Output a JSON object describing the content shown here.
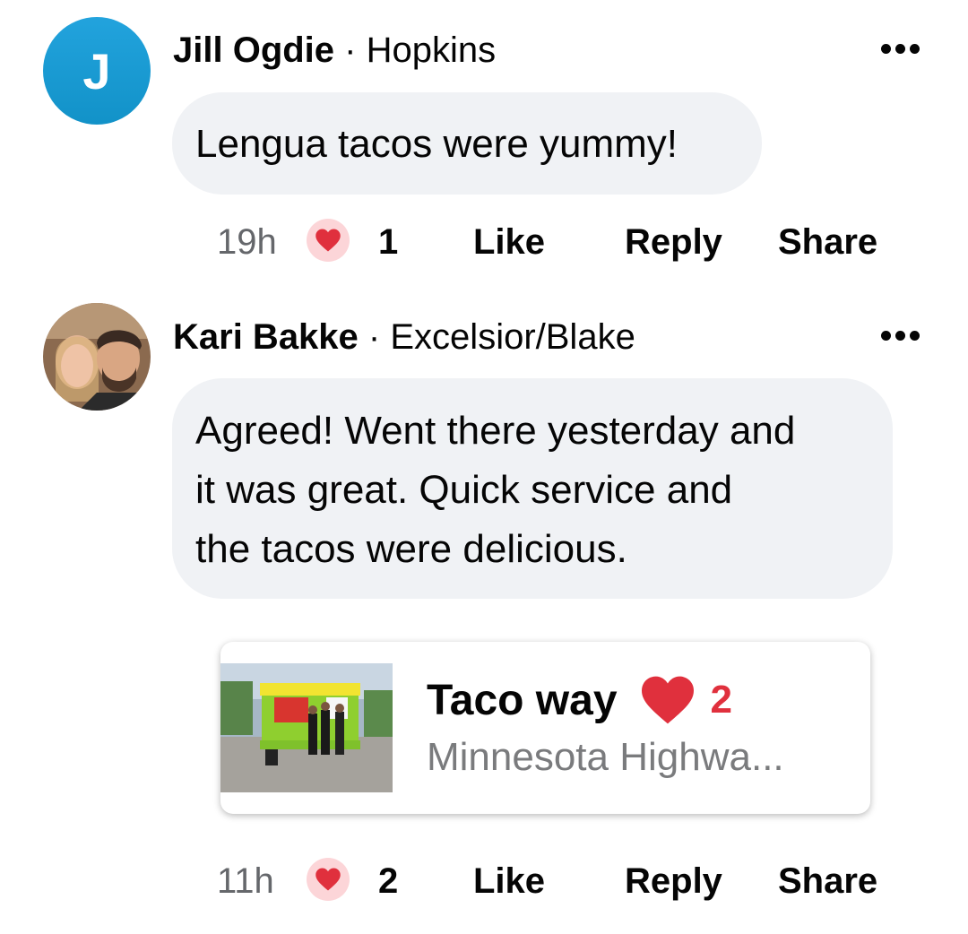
{
  "comments": [
    {
      "avatar_letter": "J",
      "name": "Jill Ogdie",
      "separator": "·",
      "location": "Hopkins",
      "text": "Lengua tacos were yummy!",
      "time": "19h",
      "reaction_icon": "heart-icon",
      "reaction_count": "1",
      "like_label": "Like",
      "reply_label": "Reply",
      "share_label": "Share"
    },
    {
      "name": "Kari Bakke",
      "separator": "·",
      "location": "Excelsior/Blake",
      "text": "Agreed! Went there yesterday and\nit was great. Quick service and\nthe tacos were delicious.",
      "time": "11h",
      "reaction_icon": "heart-icon",
      "reaction_count": "2",
      "like_label": "Like",
      "reply_label": "Reply",
      "share_label": "Share",
      "attachment": {
        "title": "Taco way",
        "heart_count": "2",
        "subtitle": "Minnesota Highwa..."
      }
    }
  ],
  "colors": {
    "bubble_bg": "#f0f2f5",
    "reaction_red": "#e0303d",
    "meta_gray": "#65676b"
  }
}
